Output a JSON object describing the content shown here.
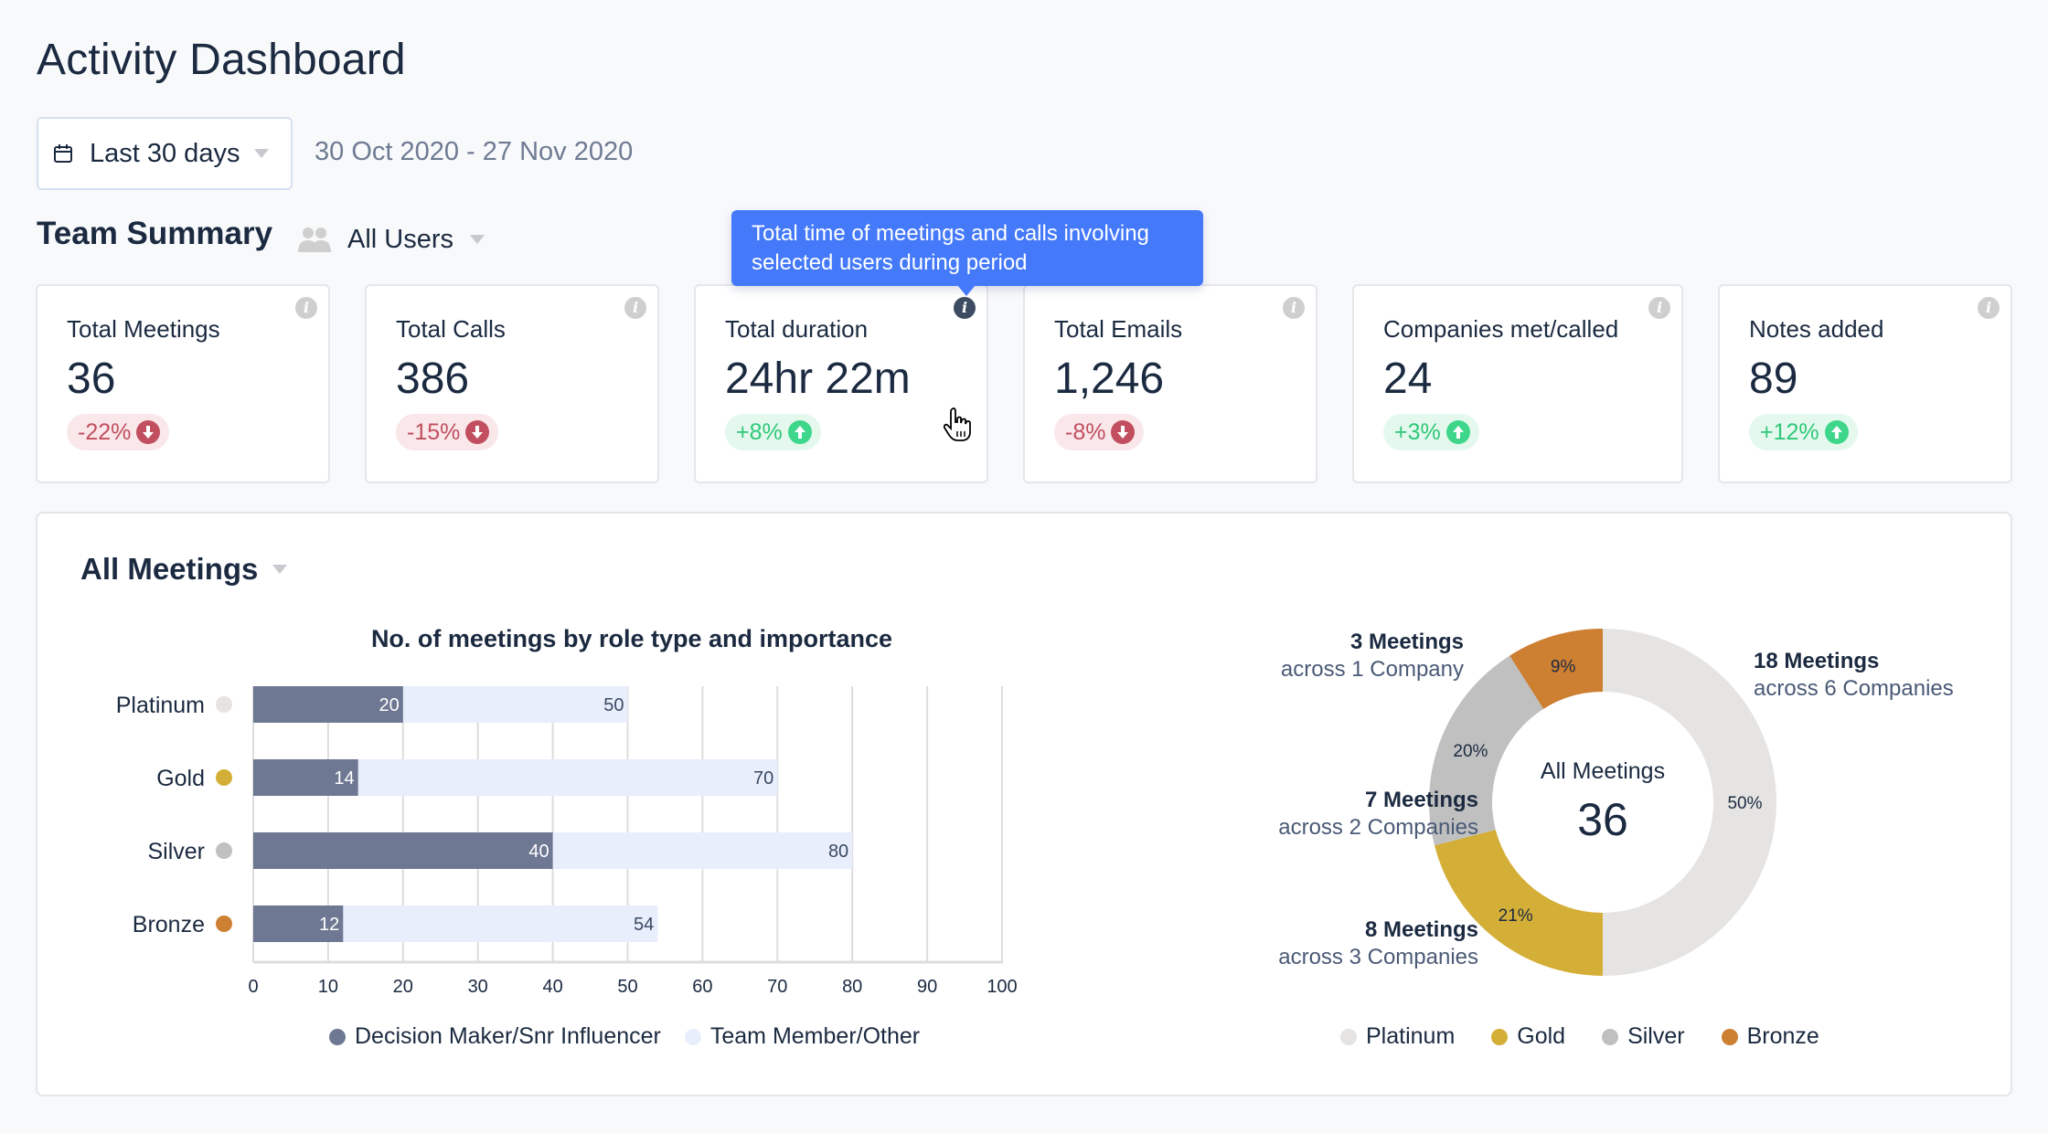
{
  "page": {
    "title": "Activity Dashboard"
  },
  "date_filter": {
    "icon": "calendar-icon",
    "selected": "Last 30 days",
    "range_text": "30 Oct 2020 - 27 Nov 2020"
  },
  "team_summary": {
    "title": "Team Summary",
    "users_filter": {
      "icon": "users-icon",
      "selected": "All Users"
    }
  },
  "tooltip": {
    "text": "Total time of meetings and calls involving selected users during period"
  },
  "cards": [
    {
      "label": "Total Meetings",
      "value": "36",
      "change": "-22%",
      "direction": "down"
    },
    {
      "label": "Total Calls",
      "value": "386",
      "change": "-15%",
      "direction": "down"
    },
    {
      "label": "Total duration",
      "value": "24hr 22m",
      "change": "+8%",
      "direction": "up"
    },
    {
      "label": "Total Emails",
      "value": "1,246",
      "change": "-8%",
      "direction": "down"
    },
    {
      "label": "Companies met/called",
      "value": "24",
      "change": "+3%",
      "direction": "up"
    },
    {
      "label": "Notes added",
      "value": "89",
      "change": "+12%",
      "direction": "up"
    }
  ],
  "colors": {
    "up": "#3ed68a",
    "down": "#c14f5f",
    "tooltip": "#4479fa",
    "decision_maker": "#6e7892",
    "team_member": "#e8eefc",
    "platinum": "#e5e4e2",
    "gold": "#d4af37",
    "silver": "#c0c0c0",
    "bronze": "#cd7f32"
  },
  "meetings_panel": {
    "title": "All Meetings"
  },
  "chart_data": [
    {
      "type": "bar",
      "orientation": "horizontal",
      "overlay": true,
      "title": "No. of meetings by role type and importance",
      "categories": [
        "Platinum",
        "Gold",
        "Silver",
        "Bronze"
      ],
      "category_colors": [
        "#e5e4e2",
        "#d4af37",
        "#c0c0c0",
        "#cd7f32"
      ],
      "series": [
        {
          "name": "Decision Maker/Snr Influencer",
          "color": "#6e7892",
          "values": [
            20,
            14,
            40,
            12
          ]
        },
        {
          "name": "Team Member/Other",
          "color": "#e8eefc",
          "values": [
            50,
            70,
            80,
            54
          ]
        }
      ],
      "xlim": [
        0,
        100
      ],
      "xticks": [
        "0",
        "10",
        "20",
        "30",
        "40",
        "50",
        "60",
        "70",
        "80",
        "90",
        "100"
      ],
      "grid": true,
      "legend": "bottom"
    },
    {
      "type": "pie",
      "variant": "donut",
      "center_label": "All Meetings",
      "center_value": "36",
      "slices": [
        {
          "name": "Platinum",
          "percent": 50,
          "label": "50%",
          "color": "#e5e4e2",
          "meetings": "18 Meetings",
          "companies": "across 6 Companies"
        },
        {
          "name": "Gold",
          "percent": 21,
          "label": "21%",
          "color": "#d4af37",
          "meetings": "8 Meetings",
          "companies": "across 3 Companies"
        },
        {
          "name": "Silver",
          "percent": 20,
          "label": "20%",
          "color": "#c0c0c0",
          "meetings": "7 Meetings",
          "companies": "across 2 Companies"
        },
        {
          "name": "Bronze",
          "percent": 9,
          "label": "9%",
          "color": "#cd7f32",
          "meetings": "3 Meetings",
          "companies": "across 1 Company"
        }
      ],
      "legend": "bottom"
    }
  ]
}
